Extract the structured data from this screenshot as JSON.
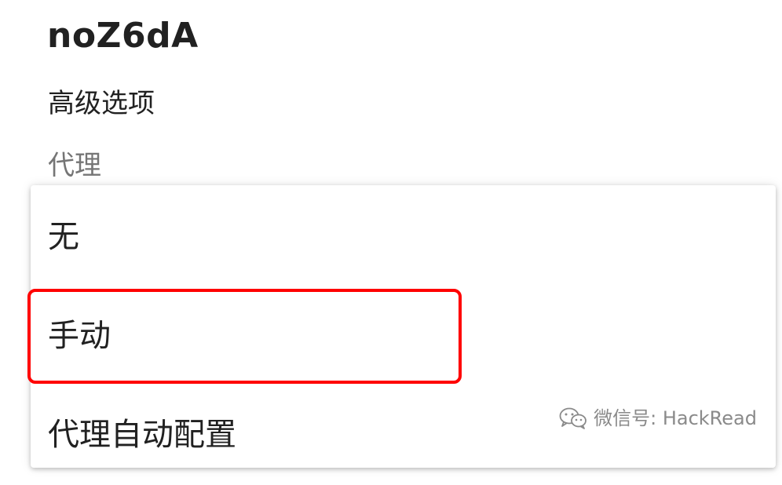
{
  "network": {
    "name": "noZ6dA"
  },
  "advanced_options_label": "高级选项",
  "proxy": {
    "label": "代理",
    "options": [
      {
        "label": "无"
      },
      {
        "label": "手动"
      },
      {
        "label": "代理自动配置"
      }
    ],
    "highlighted_option": "手动"
  },
  "watermark": {
    "text": "微信号: HackRead",
    "icon": "wechat-icon"
  },
  "colors": {
    "highlight_border": "#ff0000",
    "primary_text": "#212121",
    "secondary_text": "#757575"
  }
}
